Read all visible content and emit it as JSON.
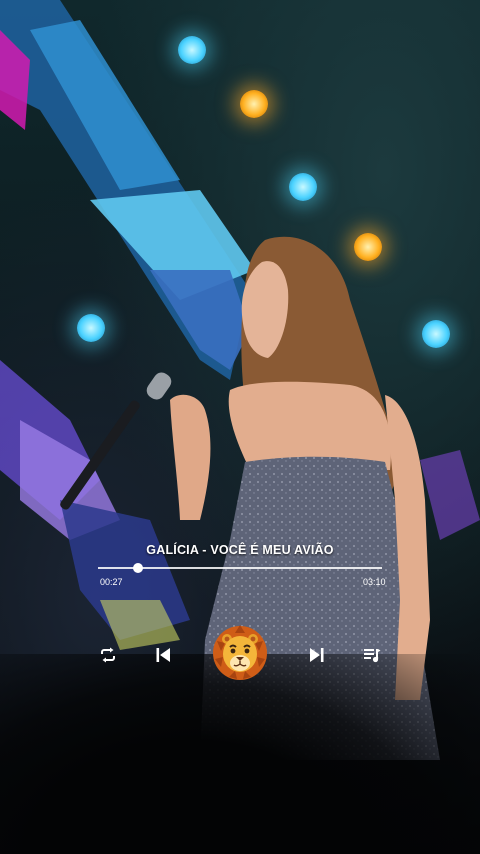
{
  "player": {
    "song_title": "GALÍCIA - VOCÊ É MEU AVIÃO",
    "elapsed": "00:27",
    "duration": "03:10",
    "progress": 0.14
  },
  "controls": {
    "repeat_icon": "repeat-icon",
    "previous_icon": "skip-previous-icon",
    "center_icon": "lion-icon",
    "next_icon": "skip-next-icon",
    "queue_icon": "playlist-icon"
  },
  "colors": {
    "accent_led_blue": "#4ab8e8",
    "accent_led_purple": "#7a5ad8",
    "lion_mane": "#d0621a",
    "lion_face": "#f4b63a"
  }
}
